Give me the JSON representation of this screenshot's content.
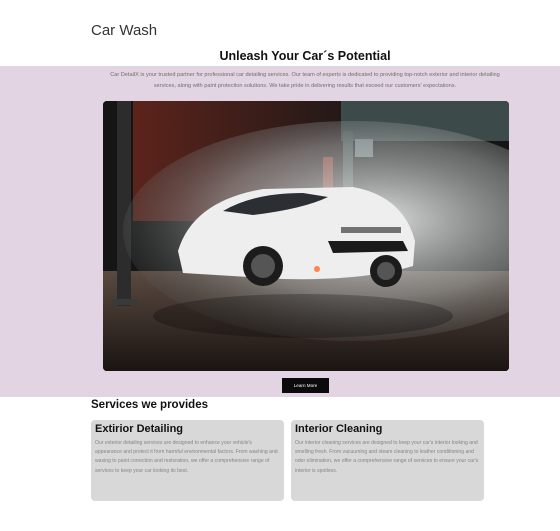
{
  "header": {
    "title": "Car Wash"
  },
  "hero": {
    "heading": "Unleash Your Car´s Potential",
    "intro": "Car DetailX is your trusted partner for professional car detailing services. Our team of experts is dedicated to providing top-notch exterior and interior detailing services, along with paint protection solutions. We take pride in delivering results that exceed our customers' expectations.",
    "cta_label": "Learn More"
  },
  "services": {
    "heading": "Services we provides",
    "cards": [
      {
        "title": "Extirior Detailing",
        "description": "Our exterior detailing services are designed to enhance your vehicle's appearance and protect it from harmful environmental factors. From washing and waxing to paint correction and restoration, we offer a comprehensive range of services to keep your car looking its best."
      },
      {
        "title": "Interior Cleaning",
        "description": "Our interior cleaning services are designed to keep your car's interior looking and smelling fresh. From vacuuming and steam cleaning to leather conditioning and odor elimination, we offer a comprehensive range of services to ensure your car's interior is spotless."
      }
    ]
  },
  "colors": {
    "hero_band": "#e2d4e3",
    "button": "#0b0b0b",
    "card": "#d8d8d8"
  }
}
